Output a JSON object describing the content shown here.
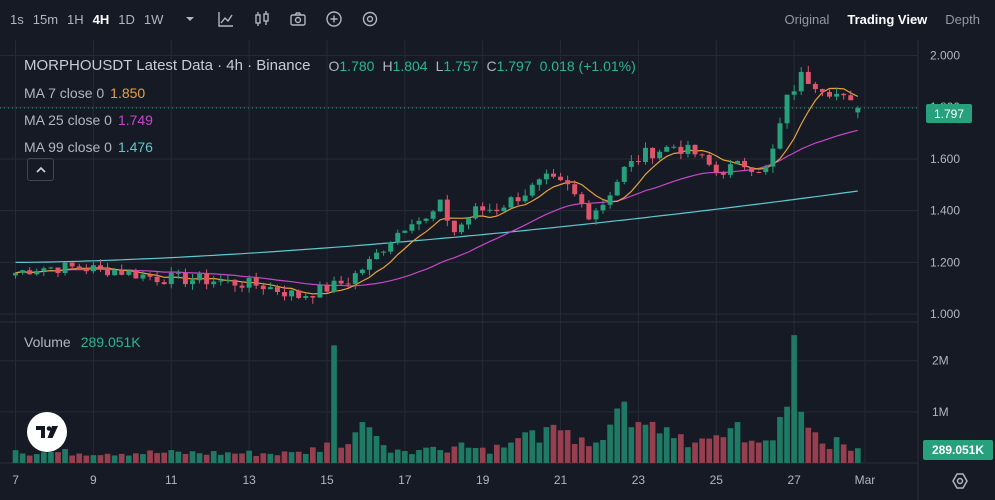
{
  "toolbar": {
    "timeframes": [
      "1s",
      "15m",
      "1H",
      "4H",
      "1D",
      "1W"
    ],
    "active_timeframe": "4H",
    "icons": [
      "chevron-down-icon",
      "indicators-icon",
      "candle-type-icon",
      "camera-icon",
      "plus-circle-icon",
      "settings-icon"
    ],
    "views": [
      "Original",
      "Trading View",
      "Depth"
    ],
    "active_view": "Trading View"
  },
  "legend": {
    "symbol_line": "MORPHOUSDT Latest Data · 4h · Binance",
    "open_label": "O",
    "open": "1.780",
    "high_label": "H",
    "high": "1.804",
    "low_label": "L",
    "low": "1.757",
    "close_label": "C",
    "close": "1.797",
    "change": "0.018 (+1.01%)",
    "ma7_label": "MA 7 close 0",
    "ma7_value": "1.850",
    "ma25_label": "MA 25 close 0",
    "ma25_value": "1.749",
    "ma99_label": "MA 99 close 0",
    "ma99_value": "1.476"
  },
  "volume": {
    "label": "Volume",
    "value": "289.051K"
  },
  "price_tag": "1.797",
  "volume_tag": "289.051K",
  "colors": {
    "up": "#26a17b",
    "down": "#e0556c",
    "vol_up": "#1e7a64",
    "vol_down": "#96404f",
    "ma7": "#e5a13c",
    "ma25": "#c548c8",
    "ma99": "#5fc8cf",
    "grid": "#262a35",
    "axis_text": "#b2b5be"
  },
  "chart_data": {
    "type": "candlestick",
    "symbol": "MORPHOUSDT",
    "interval": "4h",
    "price_axis": {
      "ticks": [
        "1.000",
        "1.200",
        "1.400",
        "1.600",
        "1.800",
        "2.000"
      ],
      "range": [
        0.985,
        2.06
      ]
    },
    "volume_axis": {
      "ticks": [
        "1M",
        "2M"
      ],
      "range": [
        0,
        2.6
      ]
    },
    "x_axis": {
      "ticks": [
        "7",
        "9",
        "11",
        "13",
        "15",
        "17",
        "19",
        "21",
        "23",
        "25",
        "27",
        "Mar"
      ]
    },
    "bar_count": 120,
    "candle_segments": [
      [
        0,
        1.16
      ],
      [
        3,
        1.18
      ],
      [
        8,
        1.18
      ],
      [
        14,
        1.17
      ],
      [
        20,
        1.14
      ],
      [
        28,
        1.13
      ],
      [
        35,
        1.11
      ],
      [
        40,
        1.07
      ],
      [
        44,
        1.1
      ],
      [
        47,
        1.13
      ],
      [
        50,
        1.2
      ],
      [
        53,
        1.29
      ],
      [
        56,
        1.37
      ],
      [
        58,
        1.36
      ],
      [
        60,
        1.42
      ],
      [
        62,
        1.32
      ],
      [
        65,
        1.4
      ],
      [
        68,
        1.41
      ],
      [
        72,
        1.47
      ],
      [
        75,
        1.52
      ],
      [
        78,
        1.49
      ],
      [
        81,
        1.39
      ],
      [
        83,
        1.43
      ],
      [
        86,
        1.56
      ],
      [
        89,
        1.62
      ],
      [
        93,
        1.65
      ],
      [
        96,
        1.62
      ],
      [
        99,
        1.55
      ],
      [
        103,
        1.58
      ],
      [
        106,
        1.56
      ],
      [
        107,
        1.63
      ],
      [
        109,
        1.83
      ],
      [
        111,
        1.92
      ],
      [
        114,
        1.88
      ],
      [
        116,
        1.85
      ],
      [
        118,
        1.81
      ],
      [
        119,
        1.797
      ]
    ],
    "volume_segments": [
      [
        0,
        0.25
      ],
      [
        40,
        0.22
      ],
      [
        44,
        0.4
      ],
      [
        45,
        2.3
      ],
      [
        46,
        0.3
      ],
      [
        48,
        0.6
      ],
      [
        49,
        0.8
      ],
      [
        50,
        0.7
      ],
      [
        52,
        0.35
      ],
      [
        58,
        0.3
      ],
      [
        63,
        0.4
      ],
      [
        66,
        0.3
      ],
      [
        70,
        0.4
      ],
      [
        72,
        0.6
      ],
      [
        75,
        0.7
      ],
      [
        80,
        0.5
      ],
      [
        82,
        0.4
      ],
      [
        84,
        0.75
      ],
      [
        86,
        1.2
      ],
      [
        87,
        0.7
      ],
      [
        88,
        0.8
      ],
      [
        92,
        0.7
      ],
      [
        96,
        0.4
      ],
      [
        102,
        0.8
      ],
      [
        105,
        0.4
      ],
      [
        108,
        0.9
      ],
      [
        109,
        1.1
      ],
      [
        110,
        2.5
      ],
      [
        111,
        1.0
      ],
      [
        113,
        0.6
      ],
      [
        119,
        0.29
      ]
    ],
    "last": {
      "open": 1.78,
      "high": 1.804,
      "low": 1.757,
      "close": 1.797,
      "volume_k": 289.051
    },
    "ma7_last": 1.85,
    "ma25_last": 1.749,
    "ma99_last": 1.476,
    "ma99_start": 1.2
  }
}
